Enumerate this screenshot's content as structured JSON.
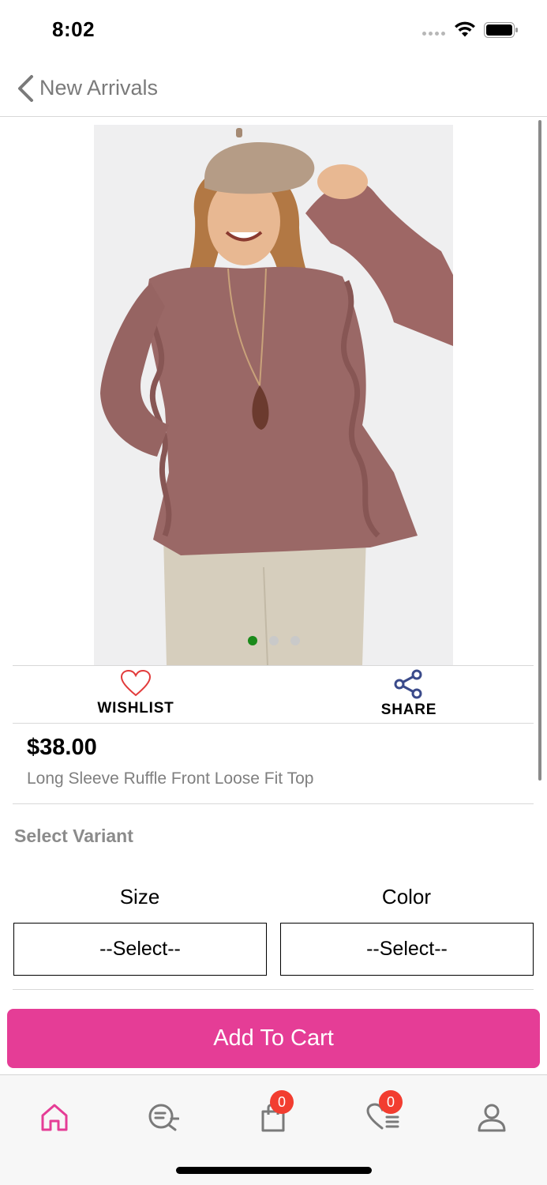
{
  "status_bar": {
    "time": "8:02"
  },
  "nav": {
    "back_label": "New Arrivals"
  },
  "product": {
    "price": "$38.00",
    "name": "Long Sleeve Ruffle Front Loose Fit Top",
    "image_slide": 1,
    "image_slide_count": 3
  },
  "actions": {
    "wishlist_label": "WISHLIST",
    "share_label": "SHARE"
  },
  "variants": {
    "title": "Select Variant",
    "size_label": "Size",
    "size_value": "--Select--",
    "color_label": "Color",
    "color_value": "--Select--"
  },
  "cart": {
    "button_label": "Add To Cart"
  },
  "tab_bar": {
    "cart_badge": "0",
    "wishlist_badge": "0",
    "active": "home",
    "tabs": [
      "home-icon",
      "search-list-icon",
      "shopping-bag-icon",
      "wishlist-list-icon",
      "profile-icon"
    ]
  },
  "colors": {
    "accent": "#e53d96",
    "badge": "#f23d30",
    "active_dot": "#1a8a1a",
    "wishlist_heart": "#e23b3b",
    "share_icon": "#3a4a8a"
  }
}
